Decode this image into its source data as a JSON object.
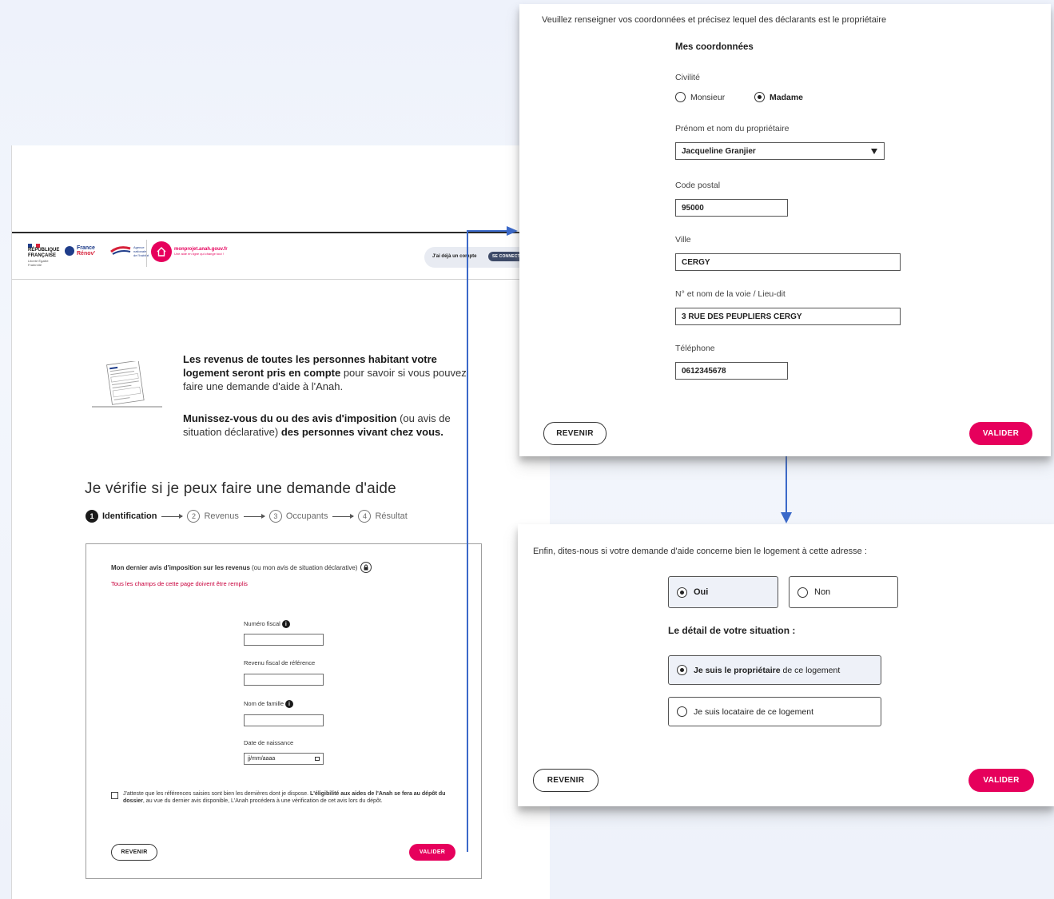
{
  "left": {
    "header": {
      "republique": [
        "RÉPUBLIQUE",
        "FRANÇAISE"
      ],
      "devise": "Liberté Égalité Fraternité",
      "france_renov": [
        "France",
        "Rénov'"
      ],
      "agence": [
        "Agence",
        "nationale",
        "de l'habitat"
      ],
      "site_name": "monprojet.anah.gouv.fr",
      "site_tagline": "Une aide en ligne qui change tout !",
      "account_text": "J'ai déjà un compte",
      "connect_button": "SE CONNECT"
    },
    "intro": {
      "p1_bold": "Les revenus de toutes les personnes habitant votre logement seront pris en compte",
      "p1_rest": " pour savoir si vous pouvez faire une demande d'aide à l'Anah.",
      "p2_bold1": "Munissez-vous du ou des avis d'imposition",
      "p2_mid": " (ou avis de situation déclarative) ",
      "p2_bold2": "des personnes vivant chez vous."
    },
    "heading": "Je vérifie si je peux faire une demande d'aide",
    "steps": [
      {
        "num": "1",
        "label": "Identification"
      },
      {
        "num": "2",
        "label": "Revenus"
      },
      {
        "num": "3",
        "label": "Occupants"
      },
      {
        "num": "4",
        "label": "Résultat"
      }
    ],
    "form": {
      "title_bold": "Mon dernier avis d'imposition sur les revenus",
      "title_rest": " (ou mon avis de situation déclarative)",
      "required_note": "Tous les champs de cette page doivent être remplis",
      "numero_fiscal": "Numéro fiscal",
      "revenu_fiscal": "Revenu fiscal de référence",
      "nom_famille": "Nom de famille",
      "date_naissance": "Date de naissance",
      "date_placeholder": "jj/mm/aaaa",
      "attest_1": "J'atteste que les références saisies sont bien les dernières dont je dispose. ",
      "attest_bold": "L'éligibilité aux aides de l'Anah se fera au dépôt du dossier",
      "attest_2": ", au vue du dernier avis disponible, L'Anah procédera à une vérification de cet avis lors du dépôt.",
      "back_button": "REVENIR",
      "submit_button": "VALIDER"
    }
  },
  "top_panel": {
    "instruction": "Veuillez renseigner vos coordonnées et précisez lequel des déclarants est le propriétaire",
    "section_title": "Mes coordonnées",
    "civilite_label": "Civilité",
    "civilite_options": [
      "Monsieur",
      "Madame"
    ],
    "civilite_selected": "Madame",
    "owner_label": "Prénom et nom du propriétaire",
    "owner_value": "Jacqueline Granjier",
    "postal_label": "Code postal",
    "postal_value": "95000",
    "city_label": "Ville",
    "city_value": "CERGY",
    "street_label": "N° et nom de la voie / Lieu-dit",
    "street_value": "3 RUE DES PEUPLIERS CERGY",
    "phone_label": "Téléphone",
    "phone_value": "0612345678",
    "back_button": "REVENIR",
    "submit_button": "VALIDER"
  },
  "bottom_panel": {
    "question": "Enfin, dites-nous si votre demande d'aide concerne bien le logement à cette adresse :",
    "yes": "Oui",
    "no": "Non",
    "situation_title": "Le détail de votre situation :",
    "owner_bold": "Je suis le propriétaire",
    "owner_rest": " de ce logement",
    "tenant": "Je suis locataire de ce logement",
    "back_button": "REVENIR",
    "submit_button": "VALIDER"
  },
  "colors": {
    "accent_pink": "#e6005c",
    "connector_blue": "#3b69c9",
    "required_red": "#c8003c"
  }
}
